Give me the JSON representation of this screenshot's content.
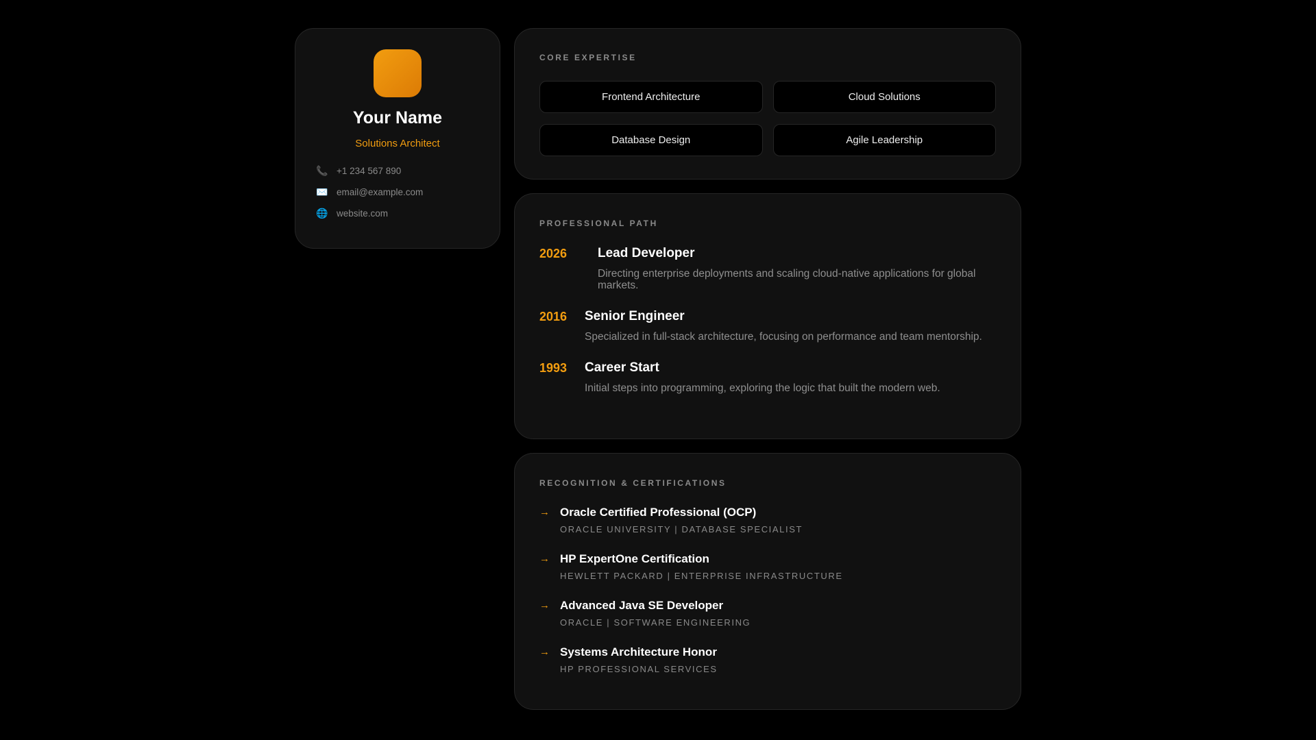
{
  "profile": {
    "name": "Your Name",
    "role": "Solutions Architect",
    "contacts": [
      {
        "icon": "phone-icon",
        "glyph": "📞",
        "text": "+1 234 567 890"
      },
      {
        "icon": "envelope-icon",
        "glyph": "✉️",
        "text": "email@example.com"
      },
      {
        "icon": "globe-icon",
        "glyph": "🌐",
        "text": "website.com"
      }
    ]
  },
  "expertise": {
    "label": "Core Expertise",
    "items": [
      "Frontend Architecture",
      "Cloud Solutions",
      "Database Design",
      "Agile Leadership"
    ]
  },
  "path": {
    "label": "Professional Path",
    "items": [
      {
        "year": "2026",
        "title": "Lead Developer",
        "desc": "Directing enterprise deployments and scaling cloud-native applications for global markets."
      },
      {
        "year": "2016",
        "title": "Senior Engineer",
        "desc": "Specialized in full-stack architecture, focusing on performance and team mentorship."
      },
      {
        "year": "1993",
        "title": "Career Start",
        "desc": "Initial steps into programming, exploring the logic that built the modern web."
      }
    ]
  },
  "certs": {
    "label": "Recognition & Certifications",
    "arrow": "→",
    "items": [
      {
        "title": "Oracle Certified Professional (OCP)",
        "sub": "Oracle University | Database Specialist"
      },
      {
        "title": "HP ExpertOne Certification",
        "sub": "Hewlett Packard | Enterprise Infrastructure"
      },
      {
        "title": "Advanced Java SE Developer",
        "sub": "Oracle | Software Engineering"
      },
      {
        "title": "Systems Architecture Honor",
        "sub": "HP Professional Services"
      }
    ]
  },
  "colors": {
    "accent": "#f29d10",
    "card": "#111111",
    "bg": "#000000"
  }
}
